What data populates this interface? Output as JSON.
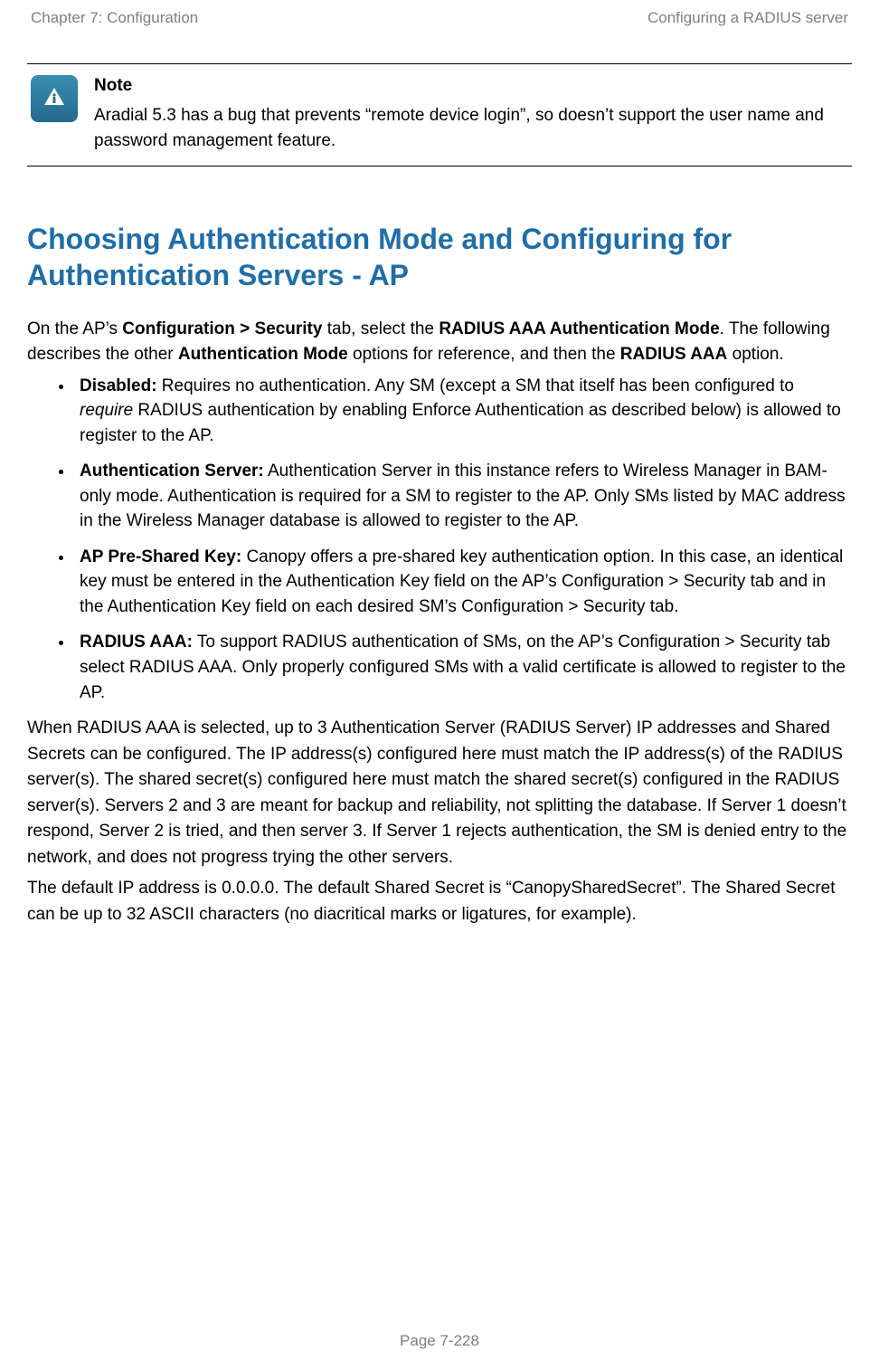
{
  "header": {
    "left": "Chapter 7:  Configuration",
    "right": "Configuring a RADIUS server"
  },
  "note": {
    "title": "Note",
    "body": "Aradial 5.3 has a bug that prevents “remote device login”, so doesn’t support the user name and password management feature."
  },
  "section_title": "Choosing Authentication Mode and Configuring for Authentication Servers - AP",
  "intro": {
    "p1a": "On the AP’s ",
    "p1b": "Configuration > Security",
    "p1c": " tab, select the ",
    "p1d": "RADIUS AAA Authentication Mode",
    "p1e": ". The following describes the other ",
    "p1f": "Authentication Mode",
    "p1g": " options for reference, and then the ",
    "p1h": "RADIUS AAA",
    "p1i": " option."
  },
  "bullets": {
    "b1": {
      "label": "Disabled:",
      "t1": " Requires no authentication. Any SM (except a SM that itself has been configured to ",
      "it": "require",
      "t2": " RADIUS authentication by enabling Enforce Authentication as described below) is allowed to register to the AP."
    },
    "b2": {
      "label": "Authentication Server:",
      "t1": " Authentication Server in this instance refers to Wireless Manager in BAM-only mode. Authentication is required for a SM to register to the AP. Only SMs listed by MAC address in the Wireless Manager database is allowed to register to the AP."
    },
    "b3": {
      "label": "AP Pre-Shared Key:",
      "t1": " Canopy offers a pre-shared key authentication option. In this case, an identical key must be entered in the Authentication Key field on the AP’s Configuration > Security tab and in the Authentication Key field on each desired SM’s Configuration > Security tab."
    },
    "b4": {
      "label": "RADIUS AAA:",
      "t1": " To support RADIUS authentication of SMs, on the AP’s Configuration > Security tab select RADIUS AAA. Only properly configured SMs with a valid certificate is allowed to register to the AP."
    }
  },
  "para_after1": "When RADIUS AAA is selected, up to 3 Authentication Server (RADIUS Server) IP addresses and Shared Secrets can be configured. The IP address(s) configured here must match the IP address(s) of the RADIUS server(s). The shared secret(s) configured here must match the shared secret(s) configured in the RADIUS server(s). Servers 2 and 3 are meant for backup and reliability, not splitting the database. If Server 1 doesn’t respond, Server 2 is tried, and then server 3. If Server 1 rejects authentication, the SM is denied entry to the network, and does not progress trying the other servers.",
  "para_after2": "The default IP address is 0.0.0.0. The default Shared Secret is “CanopySharedSecret”. The Shared Secret can be up to 32 ASCII characters (no diacritical marks or ligatures, for example).",
  "footer": "Page 7-228"
}
